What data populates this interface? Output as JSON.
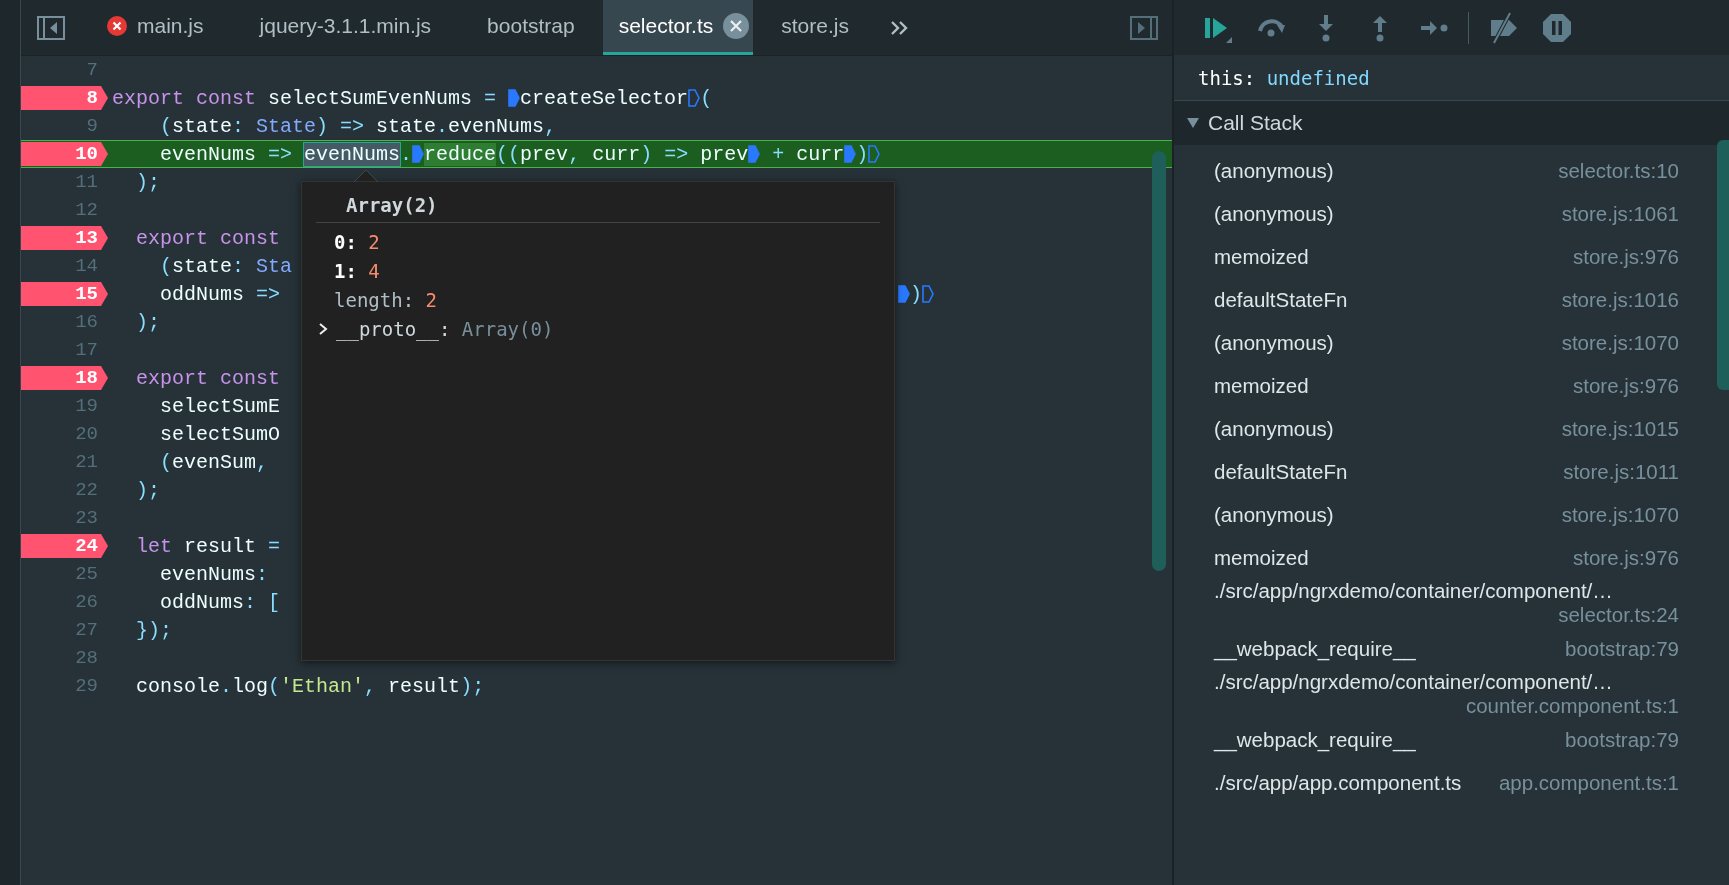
{
  "tabs": [
    {
      "label": "main.js",
      "error": true,
      "selected": false
    },
    {
      "label": "jquery-3.1.1.min.js",
      "error": false,
      "selected": false
    },
    {
      "label": "bootstrap",
      "error": false,
      "selected": false
    },
    {
      "label": "selector.ts",
      "error": false,
      "selected": true
    },
    {
      "label": "store.js",
      "error": false,
      "selected": false
    }
  ],
  "editor": {
    "lines": [
      {
        "number": "7",
        "breakpoint": false,
        "current": false
      },
      {
        "number": "8",
        "breakpoint": true,
        "current": false,
        "tokens": [
          {
            "kind": "keyword",
            "text": "export const"
          },
          {
            "kind": "plain",
            "text": " selectSumEvenNums "
          },
          {
            "kind": "punct",
            "text": "= "
          },
          {
            "kind": "marker",
            "filled": true
          },
          {
            "kind": "plain",
            "text": "createSelector"
          },
          {
            "kind": "marker",
            "filled": false
          },
          {
            "kind": "punct",
            "text": "("
          }
        ]
      },
      {
        "number": "9",
        "breakpoint": false,
        "current": false,
        "tokens": [
          {
            "kind": "punct",
            "text": "    ("
          },
          {
            "kind": "plain",
            "text": "state"
          },
          {
            "kind": "punct",
            "text": ": "
          },
          {
            "kind": "type",
            "text": "State"
          },
          {
            "kind": "punct",
            "text": ") => "
          },
          {
            "kind": "plain",
            "text": "state"
          },
          {
            "kind": "punct",
            "text": "."
          },
          {
            "kind": "plain",
            "text": "evenNums"
          },
          {
            "kind": "punct",
            "text": ","
          }
        ]
      },
      {
        "number": "10",
        "breakpoint": true,
        "current": true,
        "tokens": [
          {
            "kind": "plain",
            "text": "    evenNums "
          },
          {
            "kind": "punct",
            "text": "=> "
          },
          {
            "kind": "hovered",
            "text": "evenNums"
          },
          {
            "kind": "punct",
            "text": "."
          },
          {
            "kind": "marker",
            "filled": true
          },
          {
            "kind": "executing",
            "text": "reduce"
          },
          {
            "kind": "punct",
            "text": "(("
          },
          {
            "kind": "plain",
            "text": "prev"
          },
          {
            "kind": "punct",
            "text": ", "
          },
          {
            "kind": "plain",
            "text": "curr"
          },
          {
            "kind": "punct",
            "text": ") => "
          },
          {
            "kind": "plain",
            "text": "prev"
          },
          {
            "kind": "marker",
            "filled": true
          },
          {
            "kind": "punct",
            "text": " + "
          },
          {
            "kind": "plain",
            "text": "curr"
          },
          {
            "kind": "marker",
            "filled": true
          },
          {
            "kind": "punct",
            "text": ")"
          },
          {
            "kind": "marker",
            "filled": false
          }
        ]
      },
      {
        "number": "11",
        "breakpoint": false,
        "current": false,
        "tokens": [
          {
            "kind": "punct",
            "text": "  );"
          }
        ]
      },
      {
        "number": "12",
        "breakpoint": false,
        "current": false
      },
      {
        "number": "13",
        "breakpoint": true,
        "current": false,
        "tokens": [
          {
            "kind": "keyword",
            "text": "  export const"
          }
        ]
      },
      {
        "number": "14",
        "breakpoint": false,
        "current": false,
        "tokens": [
          {
            "kind": "punct",
            "text": "    ("
          },
          {
            "kind": "plain",
            "text": "state"
          },
          {
            "kind": "punct",
            "text": ": "
          },
          {
            "kind": "type",
            "text": "Sta"
          }
        ]
      },
      {
        "number": "15",
        "breakpoint": true,
        "current": false,
        "tokens": [
          {
            "kind": "plain",
            "text": "    oddNums "
          },
          {
            "kind": "punct",
            "text": "=>"
          }
        ],
        "after_popup": [
          {
            "kind": "marker",
            "filled": true
          },
          {
            "kind": "punct",
            "text": ")"
          },
          {
            "kind": "marker",
            "filled": false
          }
        ]
      },
      {
        "number": "16",
        "breakpoint": false,
        "current": false,
        "tokens": [
          {
            "kind": "punct",
            "text": "  );"
          }
        ]
      },
      {
        "number": "17",
        "breakpoint": false,
        "current": false
      },
      {
        "number": "18",
        "breakpoint": true,
        "current": false,
        "tokens": [
          {
            "kind": "keyword",
            "text": "  export const"
          }
        ]
      },
      {
        "number": "19",
        "breakpoint": false,
        "current": false,
        "tokens": [
          {
            "kind": "plain",
            "text": "    selectSumE"
          }
        ]
      },
      {
        "number": "20",
        "breakpoint": false,
        "current": false,
        "tokens": [
          {
            "kind": "plain",
            "text": "    selectSumO"
          }
        ]
      },
      {
        "number": "21",
        "breakpoint": false,
        "current": false,
        "tokens": [
          {
            "kind": "punct",
            "text": "    ("
          },
          {
            "kind": "plain",
            "text": "evenSum"
          },
          {
            "kind": "punct",
            "text": ","
          }
        ]
      },
      {
        "number": "22",
        "breakpoint": false,
        "current": false,
        "tokens": [
          {
            "kind": "punct",
            "text": "  );"
          }
        ]
      },
      {
        "number": "23",
        "breakpoint": false,
        "current": false
      },
      {
        "number": "24",
        "breakpoint": true,
        "current": false,
        "tokens": [
          {
            "kind": "keyword",
            "text": "  let"
          },
          {
            "kind": "plain",
            "text": " result "
          },
          {
            "kind": "punct",
            "text": "="
          }
        ]
      },
      {
        "number": "25",
        "breakpoint": false,
        "current": false,
        "tokens": [
          {
            "kind": "plain",
            "text": "    evenNums"
          },
          {
            "kind": "punct",
            "text": ":"
          }
        ]
      },
      {
        "number": "26",
        "breakpoint": false,
        "current": false,
        "tokens": [
          {
            "kind": "plain",
            "text": "    oddNums"
          },
          {
            "kind": "punct",
            "text": ": ["
          }
        ]
      },
      {
        "number": "27",
        "breakpoint": false,
        "current": false,
        "tokens": [
          {
            "kind": "punct",
            "text": "  });"
          }
        ]
      },
      {
        "number": "28",
        "breakpoint": false,
        "current": false
      },
      {
        "number": "29",
        "breakpoint": false,
        "current": false,
        "tokens": [
          {
            "kind": "plain",
            "text": "  console"
          },
          {
            "kind": "punct",
            "text": "."
          },
          {
            "kind": "plain",
            "text": "log"
          },
          {
            "kind": "punct",
            "text": "("
          },
          {
            "kind": "string",
            "text": "'Ethan'"
          },
          {
            "kind": "punct",
            "text": ", "
          },
          {
            "kind": "plain",
            "text": "result"
          },
          {
            "kind": "punct",
            "text": ");"
          }
        ]
      }
    ],
    "popover": {
      "title": "Array(2)",
      "entries": [
        {
          "kind": "index",
          "key": "0:",
          "value": "2"
        },
        {
          "kind": "index",
          "key": "1:",
          "value": "4"
        },
        {
          "kind": "property",
          "key": "length:",
          "value": "2"
        },
        {
          "kind": "proto",
          "key": "__proto__:",
          "value": "Array(0)"
        }
      ]
    }
  },
  "debugger": {
    "toolbar": [
      {
        "kind": "resume"
      },
      {
        "kind": "step-over"
      },
      {
        "kind": "step-into"
      },
      {
        "kind": "step-out"
      },
      {
        "kind": "step"
      },
      {
        "kind": "deactivate"
      },
      {
        "kind": "pause"
      }
    ],
    "scope": {
      "key": "this:",
      "value": "undefined"
    },
    "call_stack": {
      "title": "Call Stack",
      "expanded": true,
      "frames": [
        {
          "name": "(anonymous)",
          "location": "selector.ts:10"
        },
        {
          "name": "(anonymous)",
          "location": "store.js:1061"
        },
        {
          "name": "memoized",
          "location": "store.js:976"
        },
        {
          "name": "defaultStateFn",
          "location": "store.js:1016"
        },
        {
          "name": "(anonymous)",
          "location": "store.js:1070"
        },
        {
          "name": "memoized",
          "location": "store.js:976"
        },
        {
          "name": "(anonymous)",
          "location": "store.js:1015"
        },
        {
          "name": "defaultStateFn",
          "location": "store.js:1011"
        },
        {
          "name": "(anonymous)",
          "location": "store.js:1070"
        },
        {
          "name": "memoized",
          "location": "store.js:976"
        },
        {
          "name": "./src/app/ngrxdemo/container/component/…",
          "location": "selector.ts:24"
        },
        {
          "name": "__webpack_require__",
          "location": "bootstrap:79"
        },
        {
          "name": "./src/app/ngrxdemo/container/component/…",
          "location": "counter.component.ts:1"
        },
        {
          "name": "__webpack_require__",
          "location": "bootstrap:79"
        },
        {
          "name": "./src/app/app.component.ts",
          "location": "app.component.ts:1"
        }
      ]
    }
  }
}
